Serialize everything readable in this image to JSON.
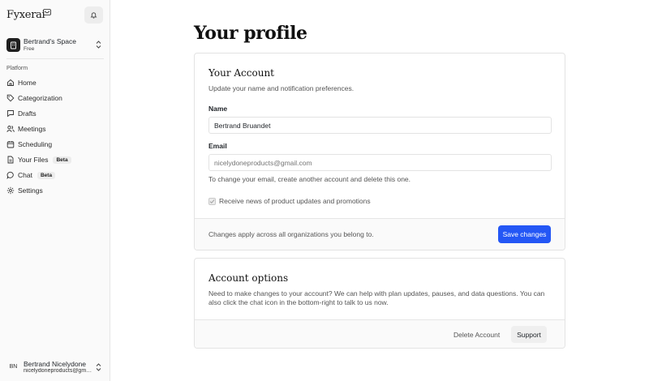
{
  "app": {
    "logo_text": "Fyxerai"
  },
  "sidebar": {
    "space": {
      "name": "Bertrand's Space",
      "plan": "Free"
    },
    "section_label": "Platform",
    "items": [
      {
        "label": "Home",
        "icon": "home-icon"
      },
      {
        "label": "Categorization",
        "icon": "tag-icon"
      },
      {
        "label": "Drafts",
        "icon": "message-icon"
      },
      {
        "label": "Meetings",
        "icon": "users-icon"
      },
      {
        "label": "Scheduling",
        "icon": "calendar-icon"
      },
      {
        "label": "Your Files",
        "icon": "file-icon",
        "badge": "Beta"
      },
      {
        "label": "Chat",
        "icon": "chat-icon",
        "badge": "Beta"
      },
      {
        "label": "Settings",
        "icon": "gear-icon"
      }
    ],
    "user": {
      "initials": "BN",
      "name": "Bertrand Nicelydone",
      "email": "nicelydoneproducts@gmail.com"
    }
  },
  "main": {
    "title": "Your profile",
    "account_card": {
      "title": "Your Account",
      "description": "Update your name and notification preferences.",
      "name_label": "Name",
      "name_value": "Bertrand Bruandet",
      "email_label": "Email",
      "email_placeholder": "nicelydoneproducts@gmail.com",
      "email_help": "To change your email, create another account and delete this one.",
      "checkbox_label": "Receive news of product updates and promotions",
      "footer_note": "Changes apply across all organizations you belong to.",
      "save_label": "Save changes"
    },
    "options_card": {
      "title": "Account options",
      "description": "Need to make changes to your account? We can help with plan updates, pauses, and data questions. You can also click the chat icon in the bottom-right to talk to us now.",
      "delete_label": "Delete Account",
      "support_label": "Support"
    }
  },
  "colors": {
    "accent": "#2457f5",
    "sidebar_bg": "#fafafa",
    "border": "#e3e3e3"
  }
}
